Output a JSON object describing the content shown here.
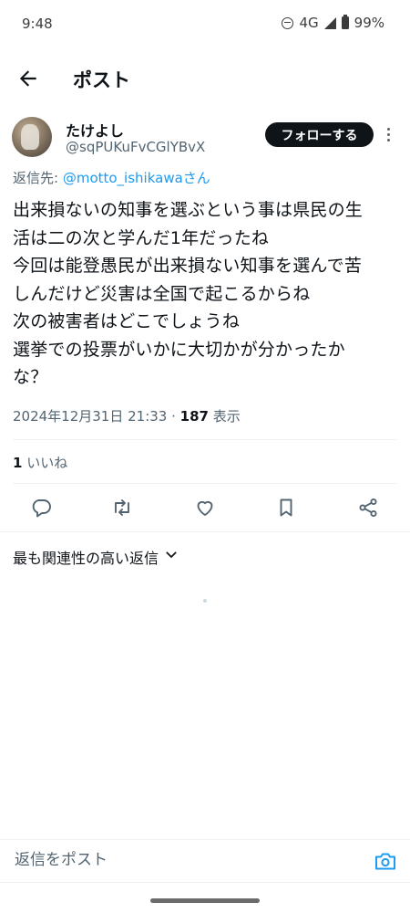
{
  "status_bar": {
    "time": "9:48",
    "network": "4G",
    "battery": "99%"
  },
  "header": {
    "title": "ポスト"
  },
  "author": {
    "display_name": "たけよし",
    "handle": "@sqPUKuFvCGlYBvX",
    "follow_label": "フォローする"
  },
  "reply_to": {
    "prefix": "返信先: ",
    "mention": "@motto_ishikawaさん"
  },
  "post": {
    "lines": [
      "出来損ないの知事を選ぶという事は県民の生",
      "活は二の次と学んだ1年だったね",
      "今回は能登愚民が出来損ない知事を選んで苦",
      "しんだけど災害は全国で起こるからね",
      "次の被害者はどこでしょうね",
      "選挙での投票がいかに大切かが分かったか",
      "な？"
    ],
    "timestamp": "2024年12月31日 21:33",
    "separator": " · ",
    "views_count": "187",
    "views_label": " 表示"
  },
  "stats": {
    "likes_count": "1",
    "likes_label": " いいね"
  },
  "actions": [
    "reply-icon",
    "retweet-icon",
    "like-icon",
    "bookmark-icon",
    "share-icon"
  ],
  "replies": {
    "sort_label": "最も関連性の高い返信"
  },
  "composer": {
    "placeholder": "返信をポスト"
  }
}
